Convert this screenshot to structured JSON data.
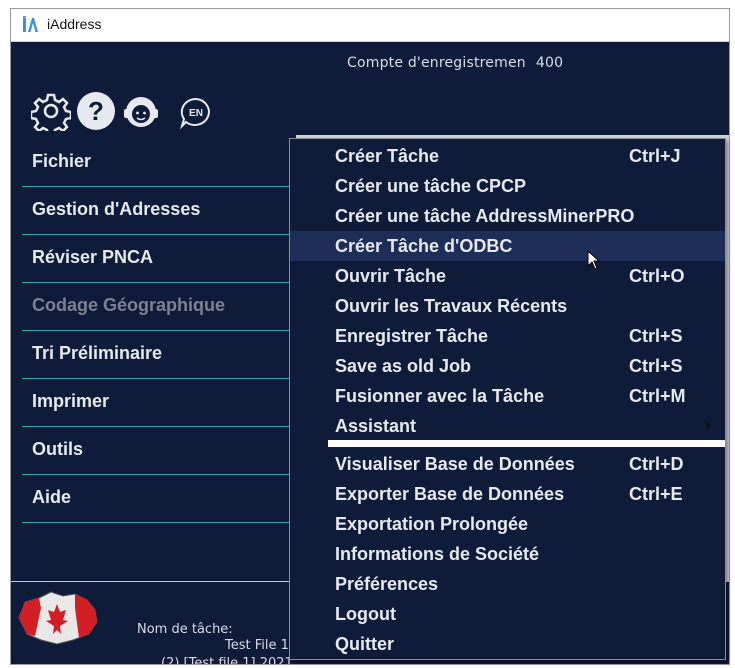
{
  "window": {
    "title": "iAddress"
  },
  "counter": {
    "label": "Compte d'enregistremen",
    "value": "400"
  },
  "toolbar": {
    "icons": [
      "gear-icon",
      "help-icon",
      "support-agent-icon",
      "language-en-icon"
    ],
    "language_label": "EN"
  },
  "nav": {
    "items": [
      {
        "label": "Fichier",
        "enabled": true
      },
      {
        "label": "Gestion d'Adresses",
        "enabled": true
      },
      {
        "label": "Réviser PNCA",
        "enabled": true
      },
      {
        "label": "Codage Géographique",
        "enabled": false
      },
      {
        "label": "Tri Préliminaire",
        "enabled": true
      },
      {
        "label": "Imprimer",
        "enabled": true
      },
      {
        "label": "Outils",
        "enabled": true
      },
      {
        "label": "Aide",
        "enabled": true
      }
    ]
  },
  "menu": {
    "highlighted_index": 3,
    "items": [
      {
        "label": "Créer Tâche",
        "shortcut": "Ctrl+J"
      },
      {
        "label": "Créer une tâche CPCP",
        "shortcut": ""
      },
      {
        "label": "Créer une tâche AddressMinerPRO",
        "shortcut": ""
      },
      {
        "label": "Créer Tâche d'ODBC",
        "shortcut": ""
      },
      {
        "label": "Ouvrir Tâche",
        "shortcut": "Ctrl+O"
      },
      {
        "label": "Ouvrir les Travaux Récents",
        "shortcut": ""
      },
      {
        "label": "Enregistrer Tâche",
        "shortcut": "Ctrl+S"
      },
      {
        "label": "Save as old Job",
        "shortcut": "Ctrl+S"
      },
      {
        "label": "Fusionner avec la Tâche",
        "shortcut": "Ctrl+M"
      },
      {
        "label": "Assistant",
        "shortcut": "",
        "submenu": true
      },
      {
        "label": "Visualiser Base de Données",
        "shortcut": "Ctrl+D"
      },
      {
        "label": "Exporter Base de Données",
        "shortcut": "Ctrl+E"
      },
      {
        "label": "Exportation Prolongée",
        "shortcut": ""
      },
      {
        "label": "Informations de Société",
        "shortcut": ""
      },
      {
        "label": "Préférences",
        "shortcut": ""
      },
      {
        "label": "Logout",
        "shortcut": ""
      },
      {
        "label": "Quitter",
        "shortcut": ""
      }
    ]
  },
  "job": {
    "label": "Nom de tâche:",
    "value": "Test File 1",
    "extra": "(2) [Test file 1] 2021"
  },
  "colors": {
    "background": "#0f1c39",
    "highlight": "#1d2f58",
    "nav_divider": "#3aa7b0",
    "text": "#e6e9f0",
    "disabled_text": "#7b8190"
  }
}
